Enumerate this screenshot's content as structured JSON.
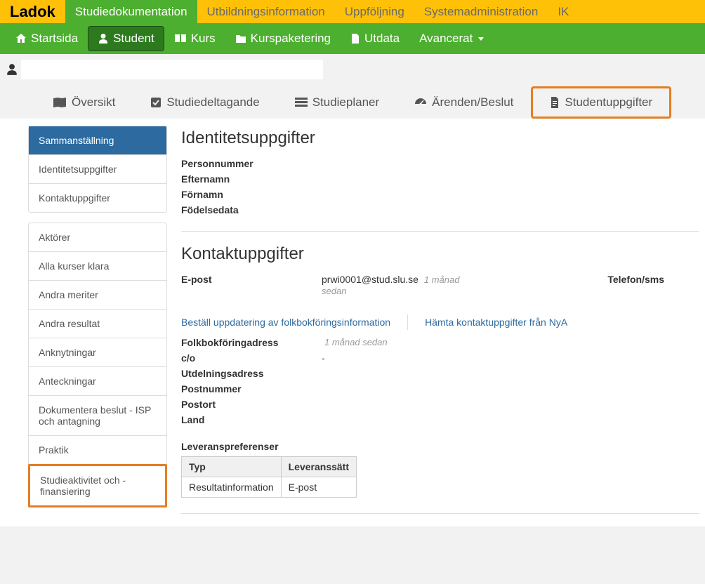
{
  "logo": "Ladok",
  "topnav": {
    "items": [
      "Studiedokumentation",
      "Utbildningsinformation",
      "Uppföljning",
      "Systemadministration",
      "IK"
    ],
    "active_index": 0
  },
  "greennav": {
    "startsida": "Startsida",
    "student": "Student",
    "kurs": "Kurs",
    "kurspaketering": "Kurspaketering",
    "utdata": "Utdata",
    "avancerat": "Avancerat"
  },
  "tabs": {
    "oversikt": "Översikt",
    "studiedeltagande": "Studiedeltagande",
    "studieplaner": "Studieplaner",
    "arenden": "Ärenden/Beslut",
    "studentuppgifter": "Studentuppgifter"
  },
  "sidebar": {
    "group1": [
      "Sammanställning",
      "Identitetsuppgifter",
      "Kontaktuppgifter"
    ],
    "group2": [
      "Aktörer",
      "Alla kurser klara",
      "Andra meriter",
      "Andra resultat",
      "Anknytningar",
      "Anteckningar",
      "Dokumentera beslut - ISP och antagning",
      "Praktik",
      "Studieaktivitet och -finansiering"
    ]
  },
  "identity": {
    "title": "Identitetsuppgifter",
    "fields": [
      "Personnummer",
      "Efternamn",
      "Förnamn",
      "Födelsedata"
    ]
  },
  "contact": {
    "title": "Kontaktuppgifter",
    "email_label": "E-post",
    "email_value": "prwi0001@stud.slu.se",
    "email_age": "1 månad sedan",
    "phone_label": "Telefon/sms",
    "link1": "Beställ uppdatering av folkbokföringsinformation",
    "link2": "Hämta kontaktuppgifter från NyA",
    "folkbok_label": "Folkbokföringadress",
    "folkbok_age": "1 månad sedan",
    "co_label": "c/o",
    "co_value": "-",
    "addr_labels": [
      "Utdelningsadress",
      "Postnummer",
      "Postort",
      "Land"
    ]
  },
  "prefs": {
    "title": "Leveranspreferenser",
    "col1": "Typ",
    "col2": "Leveranssätt",
    "row_type": "Resultatinformation",
    "row_val": "E-post"
  }
}
